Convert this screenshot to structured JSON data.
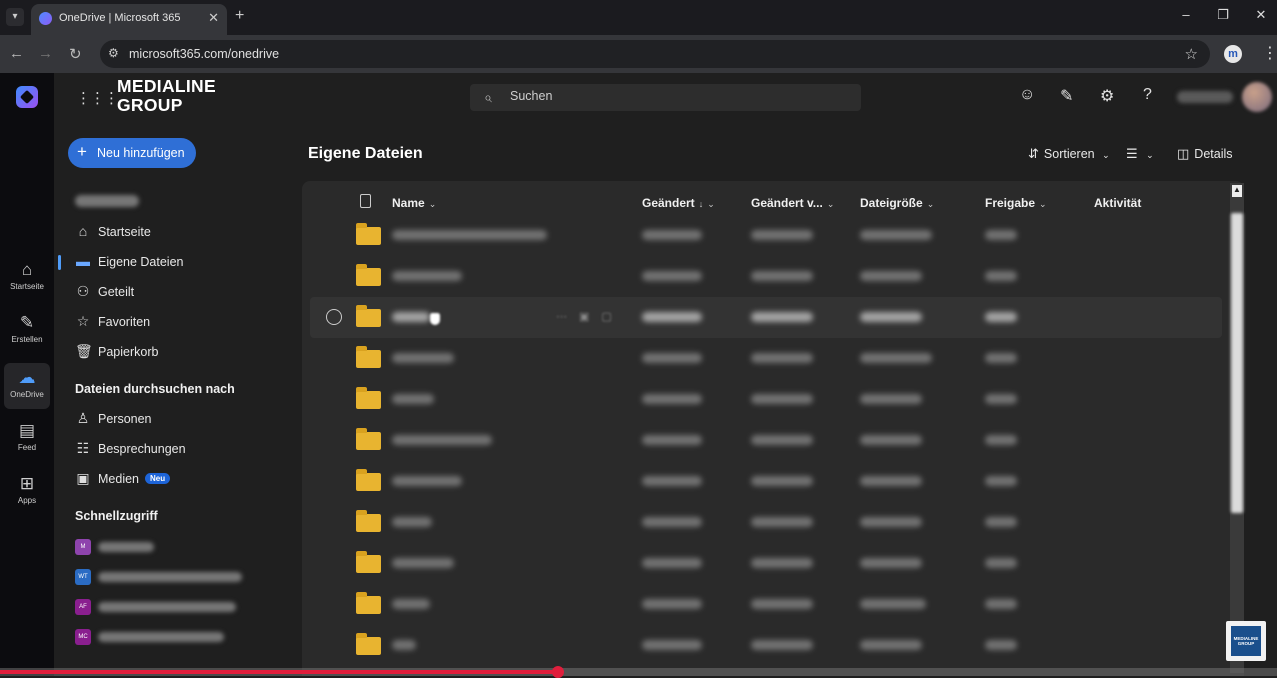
{
  "browser": {
    "tab_title": "OneDrive | Microsoft 365",
    "url": "microsoft365.com/onedrive"
  },
  "header": {
    "brand_line1": "MEDIALINE",
    "brand_line2": "GROUP",
    "search_placeholder": "Suchen"
  },
  "rail": {
    "items": [
      {
        "label": "Startseite",
        "icon": "home-icon"
      },
      {
        "label": "Erstellen",
        "icon": "pen-icon"
      },
      {
        "label": "OneDrive",
        "icon": "cloud-icon"
      },
      {
        "label": "Feed",
        "icon": "feed-icon"
      },
      {
        "label": "Apps",
        "icon": "apps-icon"
      }
    ]
  },
  "sidenav": {
    "new_button": "Neu hinzufügen",
    "items": [
      {
        "label": "Startseite",
        "icon": "home-icon"
      },
      {
        "label": "Eigene Dateien",
        "icon": "folder-icon"
      },
      {
        "label": "Geteilt",
        "icon": "people-icon"
      },
      {
        "label": "Favoriten",
        "icon": "star-icon"
      },
      {
        "label": "Papierkorb",
        "icon": "trash-icon"
      }
    ],
    "browse_heading": "Dateien durchsuchen nach",
    "browse_items": [
      {
        "label": "Personen",
        "icon": "person-icon"
      },
      {
        "label": "Besprechungen",
        "icon": "meetings-icon"
      },
      {
        "label": "Medien",
        "icon": "media-icon",
        "badge": "Neu"
      }
    ],
    "quick_heading": "Schnellzugriff",
    "quick_items": [
      {
        "tile": "M",
        "color": "#8e44ad"
      },
      {
        "tile": "WT",
        "color": "#2b6cc4"
      },
      {
        "tile": "AF",
        "color": "#8a1f8f"
      },
      {
        "tile": "MC",
        "color": "#8a1f8f"
      }
    ]
  },
  "main": {
    "title": "Eigene Dateien",
    "sort_label": "Sortieren",
    "details_label": "Details",
    "columns": {
      "name": "Name",
      "modified": "Geändert",
      "modified_by": "Geändert v...",
      "size": "Dateigröße",
      "sharing": "Freigabe",
      "activity": "Aktivität"
    }
  },
  "colors": {
    "accent": "#2f6fd6",
    "folder": "#e8b430",
    "video_progress": "#e01e3c"
  },
  "video": {
    "progress_fraction": 0.437
  },
  "watermark": {
    "line1": "MEDIALINE",
    "line2": "GROUP"
  }
}
